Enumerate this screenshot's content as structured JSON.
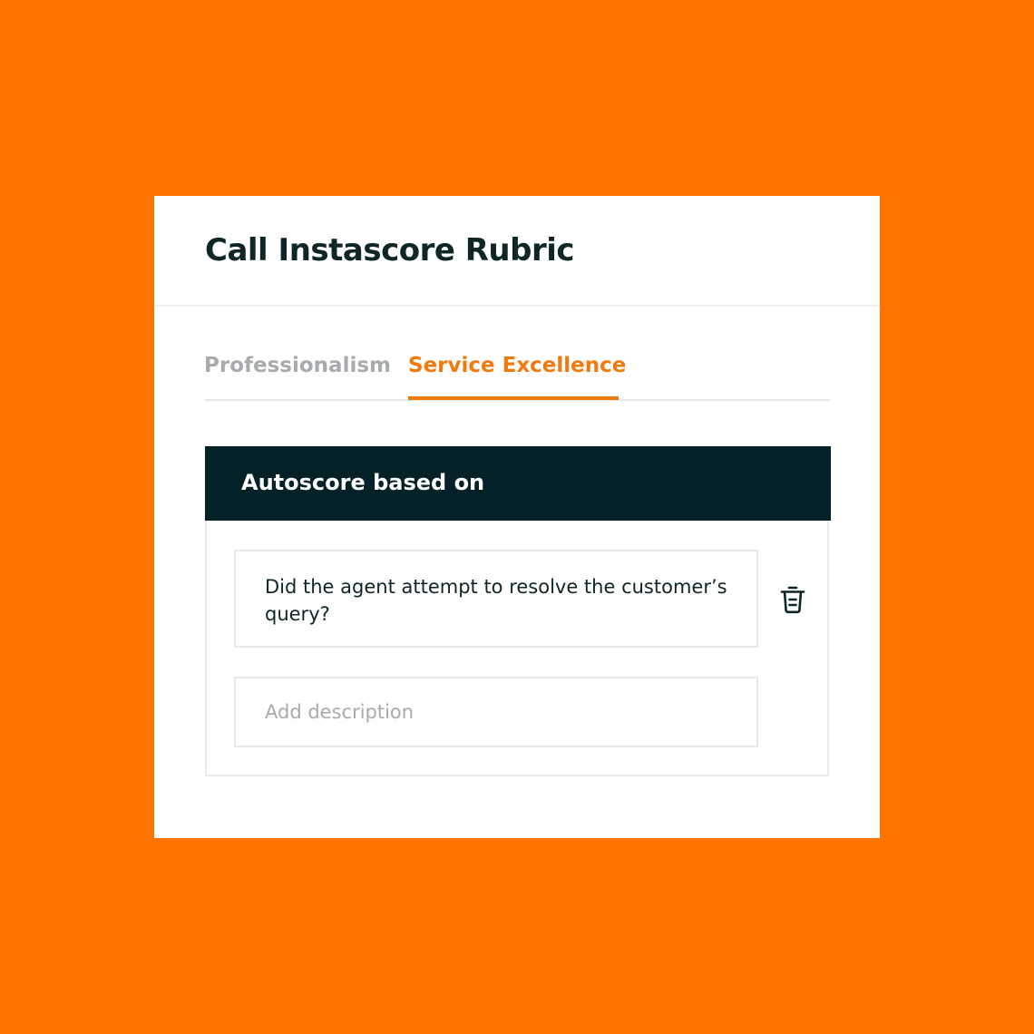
{
  "colors": {
    "background": "#FF7300",
    "accent": "#F07A0C",
    "dark": "#032126",
    "inactive_tab": "#A7ABAD"
  },
  "card": {
    "title": "Call Instascore Rubric"
  },
  "tabs": [
    {
      "label": "Professionalism",
      "active": false
    },
    {
      "label": "Service Excellence",
      "active": true
    }
  ],
  "panel": {
    "title": "Autoscore based on",
    "criterion": "Did the agent attempt to resolve the customer’s query?",
    "delete_icon": "trash-icon",
    "description_placeholder": "Add description"
  }
}
